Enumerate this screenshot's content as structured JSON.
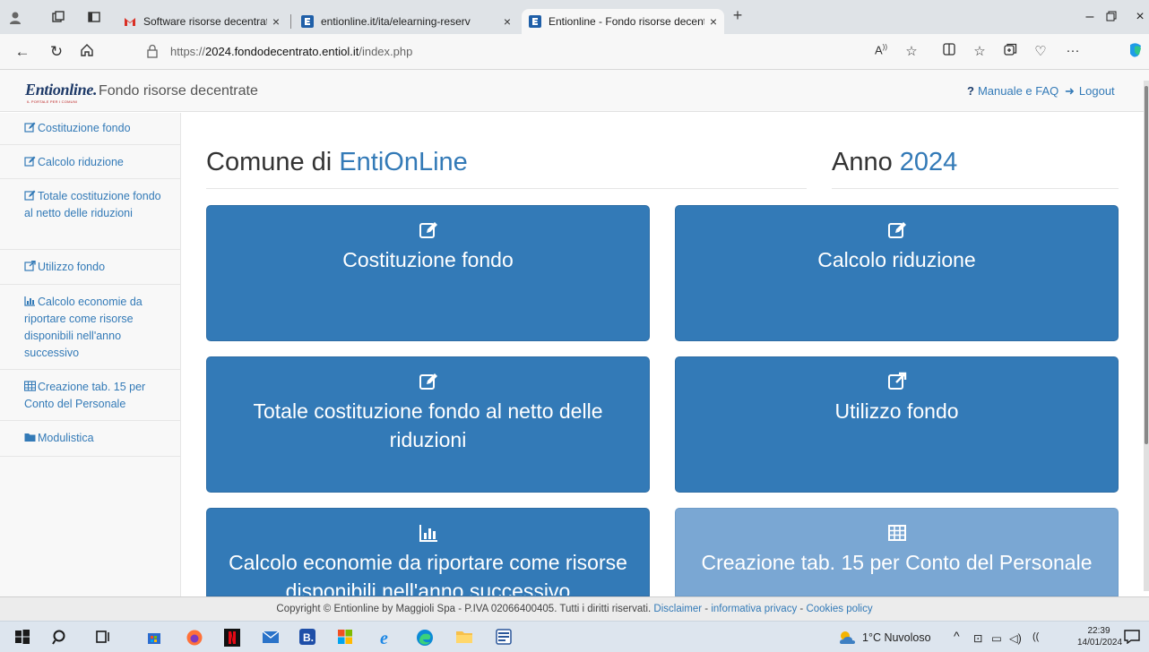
{
  "browser": {
    "tabs": [
      {
        "title": "Software risorse decentrate - ver"
      },
      {
        "title": "entionline.it/ita/elearning-reserv"
      },
      {
        "title": "Entionline - Fondo risorse decent"
      }
    ],
    "url_prefix": "https://",
    "url_host": "2024.fondodecentrato.entiol.it",
    "url_path": "/index.php",
    "plus": "+"
  },
  "header": {
    "logo": "Entionline.",
    "logo_sub": "IL PORTALE PER I COMUNI",
    "title": "Fondo risorse decentrate",
    "help_icon": "?",
    "help_label": "Manuale e FAQ",
    "logout_label": "Logout"
  },
  "sidebar": {
    "items": [
      {
        "label": "Costituzione fondo",
        "icon": "edit-icon"
      },
      {
        "label": "Calcolo riduzione",
        "icon": "edit-icon"
      },
      {
        "label": "Totale costituzione fondo al netto delle riduzioni",
        "icon": "edit-icon"
      },
      {
        "label": "Utilizzo fondo",
        "icon": "external-link-icon"
      },
      {
        "label": "Calcolo economie da riportare come risorse disponibili nell'anno successivo",
        "icon": "bar-chart-icon"
      },
      {
        "label": "Creazione tab. 15 per Conto del Personale",
        "icon": "table-icon"
      },
      {
        "label": "Modulistica",
        "icon": "folder-icon"
      }
    ]
  },
  "main": {
    "comune_prefix": "Comune di",
    "comune_name": "EntiOnLine",
    "anno_prefix": "Anno",
    "anno_value": "2024",
    "tiles": [
      {
        "label": "Costituzione fondo",
        "icon": "edit-icon"
      },
      {
        "label": "Calcolo riduzione",
        "icon": "edit-icon"
      },
      {
        "label": "Totale costituzione fondo al netto delle riduzioni",
        "icon": "edit-icon"
      },
      {
        "label": "Utilizzo fondo",
        "icon": "external-link-icon"
      },
      {
        "label": "Calcolo economie da riportare come risorse disponibili nell'anno successivo",
        "icon": "bar-chart-icon"
      },
      {
        "label": "Creazione tab. 15 per Conto del Personale",
        "icon": "table-icon",
        "disabled": true
      }
    ]
  },
  "footer": {
    "text": "Copyright © Entionline by Maggioli Spa - P.IVA 02066400405. Tutti i diritti riservati.",
    "disclaimer": "Disclaimer",
    "privacy": "informativa privacy",
    "cookies": "Cookies policy",
    "sep": "-"
  },
  "taskbar": {
    "weather": "1°C  Nuvoloso",
    "time": "22:39",
    "date": "14/01/2024"
  },
  "colors": {
    "primary": "#337ab7",
    "tile_disabled": "#7aa7d3",
    "heading": "#333333"
  }
}
